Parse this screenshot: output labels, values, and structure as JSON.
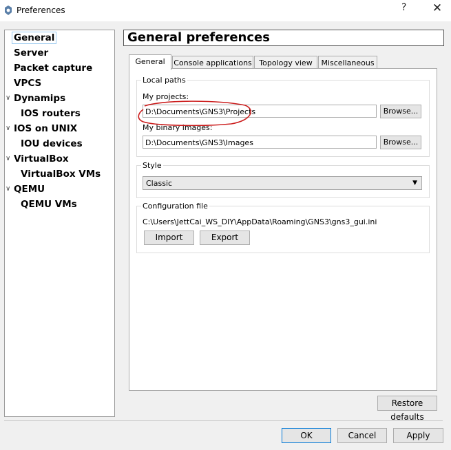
{
  "window": {
    "title": "Preferences",
    "help_glyph": "?",
    "close_glyph": "✕"
  },
  "sidebar": {
    "items": [
      {
        "label": "General",
        "expandable": false,
        "child": false
      },
      {
        "label": "Server",
        "expandable": false,
        "child": false
      },
      {
        "label": "Packet capture",
        "expandable": false,
        "child": false
      },
      {
        "label": "VPCS",
        "expandable": false,
        "child": false
      },
      {
        "label": "Dynamips",
        "expandable": true,
        "child": false
      },
      {
        "label": "IOS routers",
        "expandable": false,
        "child": true
      },
      {
        "label": "IOS on UNIX",
        "expandable": true,
        "child": false
      },
      {
        "label": "IOU devices",
        "expandable": false,
        "child": true
      },
      {
        "label": "VirtualBox",
        "expandable": true,
        "child": false
      },
      {
        "label": "VirtualBox VMs",
        "expandable": false,
        "child": true
      },
      {
        "label": "QEMU",
        "expandable": true,
        "child": false
      },
      {
        "label": "QEMU VMs",
        "expandable": false,
        "child": true
      }
    ],
    "caret_glyph": "∨"
  },
  "header": {
    "title": "General preferences"
  },
  "tabs": [
    {
      "label": "General",
      "active": true
    },
    {
      "label": "Console applications",
      "active": false
    },
    {
      "label": "Topology view",
      "active": false
    },
    {
      "label": "Miscellaneous",
      "active": false
    }
  ],
  "local_paths": {
    "group_title": "Local paths",
    "projects_label": "My projects:",
    "projects_value": "D:\\Documents\\GNS3\\Projects",
    "images_label": "My binary images:",
    "images_value": "D:\\Documents\\GNS3\\Images",
    "browse_label": "Browse..."
  },
  "style": {
    "group_title": "Style",
    "selected": "Classic"
  },
  "config_file": {
    "group_title": "Configuration file",
    "path": "C:\\Users\\JettCai_WS_DIY\\AppData\\Roaming\\GNS3\\gns3_gui.ini",
    "import_label": "Import",
    "export_label": "Export"
  },
  "footer": {
    "restore_label": "Restore defaults",
    "ok_label": "OK",
    "cancel_label": "Cancel",
    "apply_label": "Apply"
  },
  "colors": {
    "annotation": "#cc1f1f",
    "selection_border": "#99c9ef",
    "primary_border": "#0078d7"
  }
}
